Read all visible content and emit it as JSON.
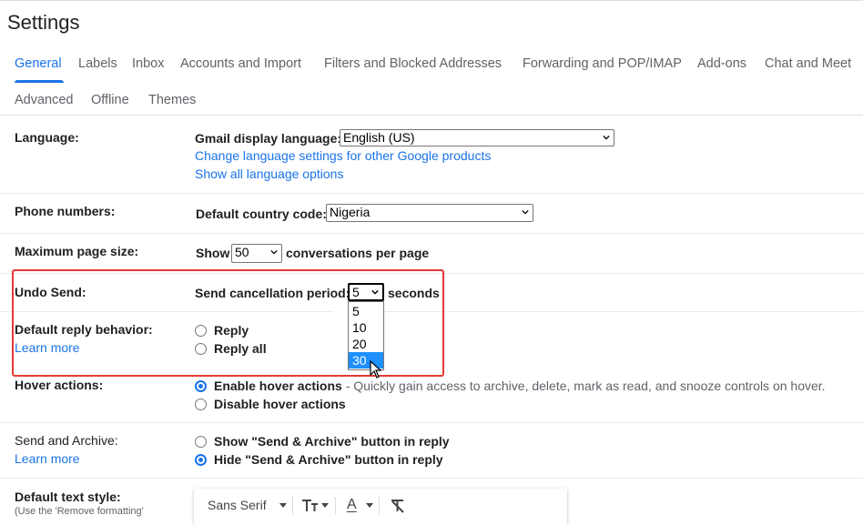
{
  "page": {
    "title": "Settings"
  },
  "tabs": [
    {
      "label": "General",
      "active": true
    },
    {
      "label": "Labels"
    },
    {
      "label": "Inbox"
    },
    {
      "label": "Accounts and Import"
    },
    {
      "label": "Filters and Blocked Addresses"
    },
    {
      "label": "Forwarding and POP/IMAP"
    },
    {
      "label": "Add-ons"
    },
    {
      "label": "Chat and Meet"
    }
  ],
  "tabs2": [
    {
      "label": "Advanced"
    },
    {
      "label": "Offline"
    },
    {
      "label": "Themes"
    }
  ],
  "language": {
    "label": "Language:",
    "display_label": "Gmail display language:",
    "display_value": "English (US)",
    "link1": "Change language settings for other Google products",
    "link2": "Show all language options"
  },
  "phone": {
    "label": "Phone numbers:",
    "country_label": "Default country code:",
    "country_value": "Nigeria"
  },
  "page_size": {
    "label": "Maximum page size:",
    "show": "Show",
    "value": "50",
    "suffix": "conversations per page"
  },
  "undo_send": {
    "label": "Undo Send:",
    "period_label": "Send cancellation period:",
    "value": "5",
    "suffix": "seconds",
    "options": [
      "5",
      "10",
      "20",
      "30"
    ],
    "highlighted_option": "30"
  },
  "reply_behavior": {
    "label": "Default reply behavior:",
    "learn_more": "Learn more",
    "option_reply": "Reply",
    "option_reply_all": "Reply all"
  },
  "hover_actions": {
    "label": "Hover actions:",
    "enable": "Enable hover actions",
    "enable_desc": "- Quickly gain access to archive, delete, mark as read, and snooze controls on hover.",
    "disable": "Disable hover actions"
  },
  "send_archive": {
    "label": "Send and Archive:",
    "learn_more": "Learn more",
    "show": "Show \"Send & Archive\" button in reply",
    "hide": "Hide \"Send & Archive\" button in reply"
  },
  "text_style": {
    "label": "Default text style:",
    "sub": "(Use the 'Remove formatting'",
    "font": "Sans Serif",
    "text_color_glyph": "A"
  },
  "colors": {
    "accent": "#1a73e8",
    "highlight": "#e53935",
    "selected_option": "#1e90ff"
  }
}
